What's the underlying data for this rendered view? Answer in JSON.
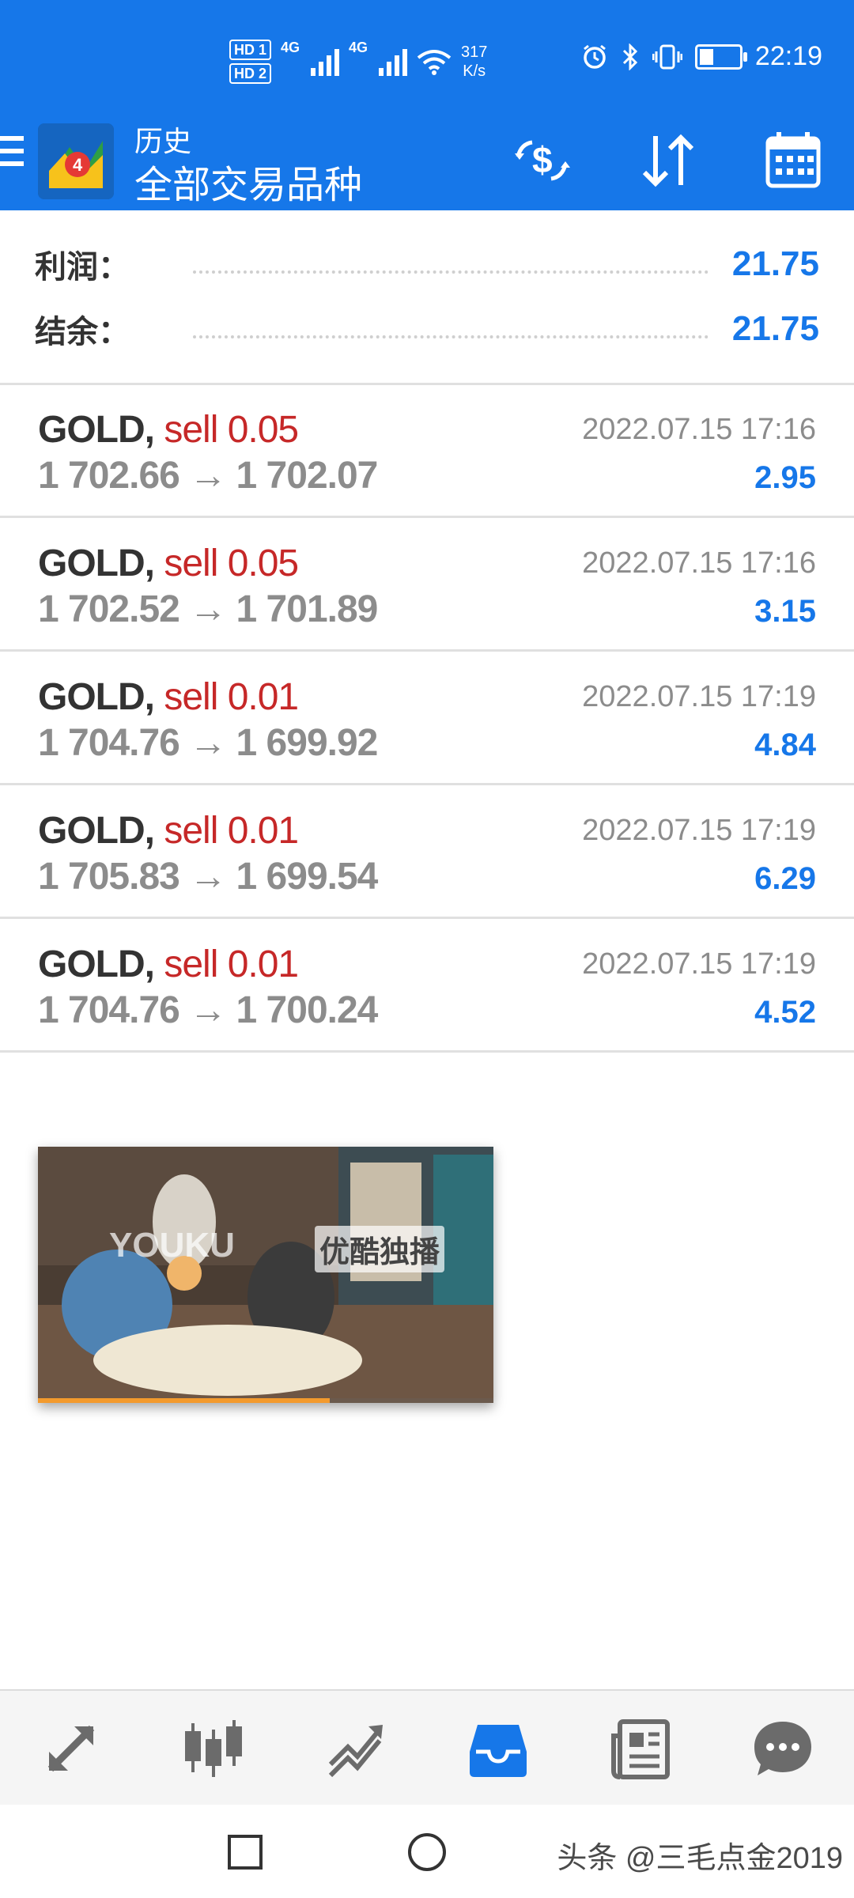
{
  "status_bar": {
    "sim1": "HD 1",
    "sim2": "HD 2",
    "net1": "4G",
    "net2": "4G",
    "speed_value": "317",
    "speed_unit": "K/s",
    "time": "22:19",
    "battery_level": 0.35
  },
  "header": {
    "subtitle": "历史",
    "title": "全部交易品种"
  },
  "summary": {
    "profit_label": "利润：",
    "profit_value": "21.75",
    "balance_label": "结余：",
    "balance_value": "21.75"
  },
  "trades": [
    {
      "symbol": "GOLD,",
      "side": "sell 0.05",
      "prices": "1 702.66 → 1 702.07",
      "time": "2022.07.15 17:16",
      "profit": "2.95"
    },
    {
      "symbol": "GOLD,",
      "side": "sell 0.05",
      "prices": "1 702.52 → 1 701.89",
      "time": "2022.07.15 17:16",
      "profit": "3.15"
    },
    {
      "symbol": "GOLD,",
      "side": "sell 0.01",
      "prices": "1 704.76 → 1 699.92",
      "time": "2022.07.15 17:19",
      "profit": "4.84"
    },
    {
      "symbol": "GOLD,",
      "side": "sell 0.01",
      "prices": "1 705.83 → 1 699.54",
      "time": "2022.07.15 17:19",
      "profit": "6.29"
    },
    {
      "symbol": "GOLD,",
      "side": "sell 0.01",
      "prices": "1 704.76 → 1 700.24",
      "time": "2022.07.15 17:19",
      "profit": "4.52"
    }
  ],
  "video": {
    "brand": "YOUKU",
    "tag": "优酷独播",
    "progress": 0.64
  },
  "bottom_nav": [
    {
      "icon": "quotes-arrows-icon",
      "active": false
    },
    {
      "icon": "chart-candles-icon",
      "active": false
    },
    {
      "icon": "trade-icon",
      "active": false
    },
    {
      "icon": "history-inbox-icon",
      "active": true
    },
    {
      "icon": "news-icon",
      "active": false
    },
    {
      "icon": "chat-icon",
      "active": false
    }
  ],
  "watermark": "头条 @三毛点金2019",
  "colors": {
    "accent": "#1677e9",
    "sell": "#c62828",
    "muted": "#8c8c8c"
  }
}
